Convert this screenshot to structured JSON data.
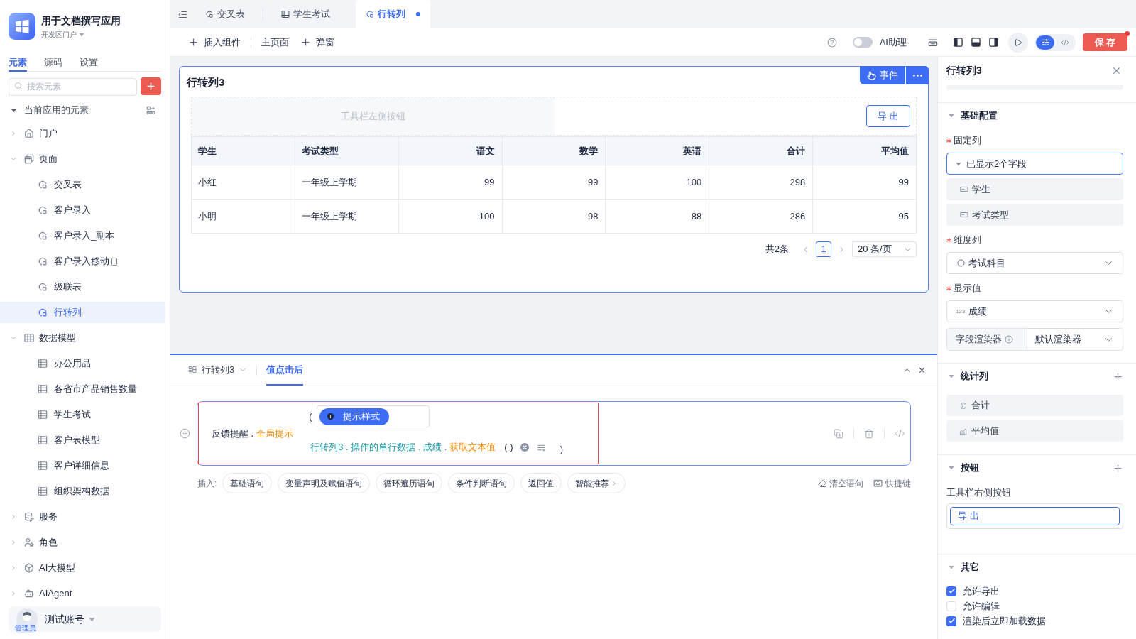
{
  "app": {
    "title": "用于文档撰写应用",
    "portal": "开发区门户"
  },
  "sidebar_tabs": [
    {
      "label": "元素",
      "selected": true
    },
    {
      "label": "源码",
      "selected": false
    },
    {
      "label": "设置",
      "selected": false
    }
  ],
  "search": {
    "placeholder": "搜索元素"
  },
  "tree": {
    "header": "当前应用的元素",
    "expanded": true,
    "items": [
      {
        "label": "门户",
        "kind": "portal",
        "expanded": false,
        "selected": false
      },
      {
        "label": "页面",
        "kind": "pages",
        "expanded": true,
        "selected": false,
        "children": [
          {
            "label": "交叉表",
            "kind": "page",
            "mobile": false,
            "selected": false
          },
          {
            "label": "客户录入",
            "kind": "page",
            "mobile": false,
            "selected": false
          },
          {
            "label": "客户录入_副本",
            "kind": "page",
            "mobile": false,
            "selected": false
          },
          {
            "label": "客户录入移动",
            "kind": "page",
            "mobile": true,
            "selected": false
          },
          {
            "label": "级联表",
            "kind": "page",
            "mobile": false,
            "selected": false
          },
          {
            "label": "行转列",
            "kind": "page",
            "mobile": false,
            "selected": true
          }
        ]
      },
      {
        "label": "数据模型",
        "kind": "models",
        "expanded": true,
        "selected": false,
        "children": [
          {
            "label": "办公用品",
            "kind": "table",
            "mobile": false,
            "selected": false
          },
          {
            "label": "各省市产品销售数量",
            "kind": "table",
            "mobile": false,
            "selected": false
          },
          {
            "label": "学生考试",
            "kind": "table",
            "mobile": false,
            "selected": false
          },
          {
            "label": "客户表模型",
            "kind": "table",
            "mobile": false,
            "selected": false
          },
          {
            "label": "客户详细信息",
            "kind": "table",
            "mobile": false,
            "selected": false
          },
          {
            "label": "组织架构数据",
            "kind": "table",
            "mobile": false,
            "selected": false
          }
        ]
      },
      {
        "label": "服务",
        "kind": "service",
        "expanded": false,
        "selected": false
      },
      {
        "label": "角色",
        "kind": "role",
        "expanded": false,
        "selected": false
      },
      {
        "label": "AI大模型",
        "kind": "model",
        "expanded": false,
        "selected": false
      },
      {
        "label": "AIAgent",
        "kind": "agent",
        "expanded": false,
        "selected": false
      }
    ]
  },
  "account": {
    "name": "测试账号",
    "badge": "管理员"
  },
  "page_tabs": [
    {
      "label": "交叉表",
      "kind": "page",
      "selected": false,
      "modified": false
    },
    {
      "label": "学生考试",
      "kind": "table",
      "selected": false,
      "modified": false
    },
    {
      "label": "行转列",
      "kind": "page",
      "selected": true,
      "modified": true
    }
  ],
  "toolbar": {
    "actions": [
      {
        "label": "插入组件",
        "kind": "add"
      },
      {
        "label": "主页面",
        "kind": "plain"
      },
      {
        "label": "弹窗",
        "kind": "add"
      }
    ],
    "assistant": {
      "label": "AI助理",
      "on": false
    },
    "modes": [
      {
        "kind": "settings",
        "selected": true
      },
      {
        "kind": "code",
        "selected": false
      }
    ],
    "save": {
      "label": "保 存",
      "notice": true
    }
  },
  "component": {
    "title": "行转列3",
    "actions": [
      {
        "kind": "event",
        "label": "事件"
      },
      {
        "kind": "more"
      }
    ],
    "toolbar_placeholder": "工具栏左侧按钮",
    "toolbar_buttons": [
      "导 出"
    ],
    "table": {
      "columns": [
        {
          "label": "学生",
          "kind": "text"
        },
        {
          "label": "考试类型",
          "kind": "text"
        },
        {
          "label": "语文",
          "kind": "number"
        },
        {
          "label": "数学",
          "kind": "number"
        },
        {
          "label": "英语",
          "kind": "number"
        },
        {
          "label": "合计",
          "kind": "number"
        },
        {
          "label": "平均值",
          "kind": "number"
        }
      ],
      "rows": [
        [
          "小红",
          "一年级上学期",
          "99",
          "99",
          "100",
          "298",
          "99"
        ],
        [
          "小明",
          "一年级上学期",
          "100",
          "98",
          "88",
          "286",
          "95"
        ]
      ]
    },
    "pagination": {
      "total": "共2条",
      "pages": [
        {
          "label": "1",
          "selected": true
        }
      ],
      "page_size": "20 条/页"
    }
  },
  "event_panel": {
    "tabs": [
      {
        "label": "行转列3",
        "kind": "component",
        "selected": false
      },
      {
        "label": "值点击后",
        "kind": "event",
        "selected": true
      }
    ],
    "statement": {
      "selected": true,
      "target": "反馈提醒 .",
      "method": "全局提示",
      "open": "(",
      "option": "提示样式",
      "path": "行转列3 . 操作的单行数据 . 成绩 .",
      "call": "获取文本值",
      "call_args": "( )",
      "close": ")"
    },
    "insert": {
      "label": "插入:",
      "options": [
        {
          "label": "基础语句",
          "more": false
        },
        {
          "label": "变量声明及赋值语句",
          "more": false
        },
        {
          "label": "循环遍历语句",
          "more": false
        },
        {
          "label": "条件判断语句",
          "more": false
        },
        {
          "label": "返回值",
          "more": false
        },
        {
          "label": "智能推荐",
          "more": true
        }
      ]
    },
    "tools": [
      {
        "label": "清空语句",
        "kind": "clear"
      },
      {
        "label": "快捷键",
        "kind": "keys"
      }
    ]
  },
  "inspector": {
    "title": "行转列3",
    "basic": {
      "title": "基础配置",
      "expanded": true,
      "fixed_columns": {
        "label": "固定列",
        "required": true,
        "focused": true,
        "expanded": true,
        "value": "已显示2个字段",
        "items": [
          "学生",
          "考试类型"
        ]
      },
      "dimension_column": {
        "label": "维度列",
        "required": true,
        "focused": false,
        "value": "考试科目"
      },
      "display_value": {
        "label": "显示值",
        "required": true,
        "focused": false,
        "type": "123",
        "value": "成绩"
      },
      "renderer": {
        "label": "字段渲染器",
        "value": "默认渲染器"
      }
    },
    "stats": {
      "title": "统计列",
      "expanded": true,
      "items": [
        {
          "label": "合计",
          "kind": "sum"
        },
        {
          "label": "平均值",
          "kind": "average"
        }
      ]
    },
    "buttons": {
      "title": "按钮",
      "expanded": true,
      "label": "工具栏右侧按钮",
      "items": [
        "导 出"
      ]
    },
    "other": {
      "title": "其它",
      "expanded": true,
      "options": [
        {
          "label": "允许导出",
          "checked": true
        },
        {
          "label": "允许编辑",
          "checked": false
        },
        {
          "label": "渲染后立即加载数据",
          "checked": true
        }
      ]
    }
  }
}
